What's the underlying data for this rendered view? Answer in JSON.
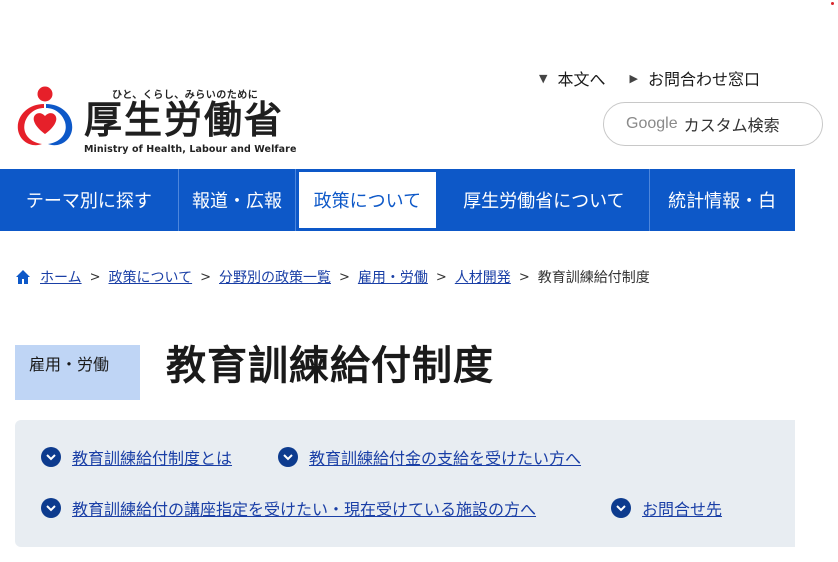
{
  "site": {
    "tagline": "ひと、くらし、みらいのために",
    "name": "厚生労働省",
    "name_en": "Ministry of Health, Labour and Welfare"
  },
  "utility": {
    "skip_link": "本文へ",
    "contact_link": "お問合わせ窓口"
  },
  "search": {
    "brand": "Google",
    "placeholder": "カスタム検索"
  },
  "nav": {
    "items": [
      {
        "label": "テーマ別に探す"
      },
      {
        "label": "報道・広報"
      },
      {
        "label": "政策について"
      },
      {
        "label": "厚生労働省について"
      },
      {
        "label": "統計情報・白"
      }
    ],
    "active_index": 2
  },
  "breadcrumb": {
    "items": [
      "ホーム",
      "政策について",
      "分野別の政策一覧",
      "雇用・労働",
      "人材開発"
    ],
    "current": "教育訓練給付制度",
    "separator": ">"
  },
  "page": {
    "category": "雇用・労働",
    "title": "教育訓練給付制度"
  },
  "toc": {
    "items": [
      {
        "label": "教育訓練給付制度とは"
      },
      {
        "label": "教育訓練給付金の支給を受けたい方へ"
      },
      {
        "label": "教育訓練給付の講座指定を受けたい・現在受けている施設の方へ"
      },
      {
        "label": "お問合せ先"
      }
    ]
  },
  "colors": {
    "primary": "#0d58c8",
    "link": "#1a3fa6",
    "badge_bg": "#bfd5f5",
    "toc_bg": "#e8edf2",
    "toc_icon": "#0d3b8e"
  }
}
